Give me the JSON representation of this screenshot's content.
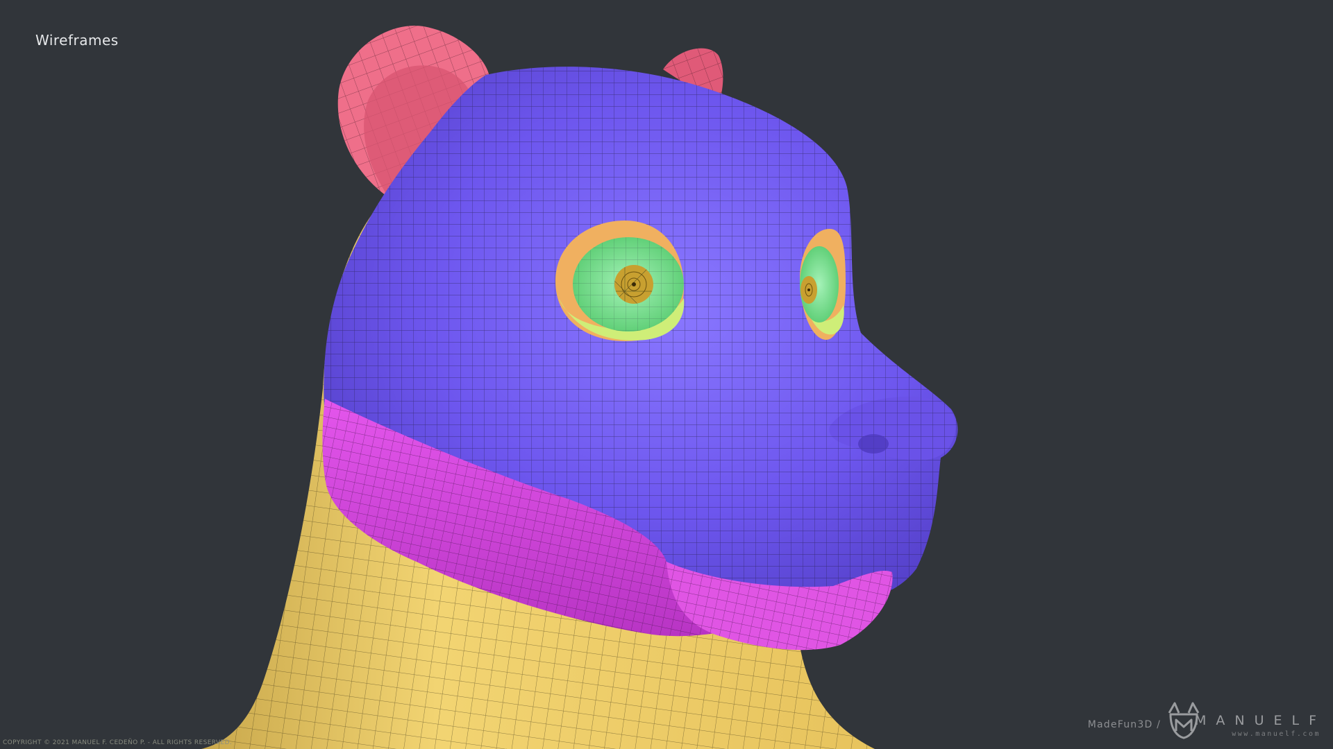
{
  "header": {
    "title": "Wireframes"
  },
  "footer": {
    "copyright": "COPYRIGHT © 2021 MANUEL F. CEDEÑO P. - ALL RIGHTS RESERVED.",
    "studio": "MadeFun3D /",
    "brand_name": "MANUELF",
    "brand_url": "www.manuelf.com"
  },
  "colors": {
    "background": "#31353a",
    "head": "#6b54ec",
    "head_highlight": "#8470ff",
    "muzzle_band": "#d848e0",
    "lip": "#e055e4",
    "neck": "#f2d270",
    "ear": "#ef6f8a",
    "eye_ring_outer": "#f0b060",
    "eye_ring_inner": "#cfee78",
    "iris": "#7ae59a",
    "pupil": "#c8a030",
    "wire": "#1c1830"
  },
  "scene": {
    "subject": "bear-head-3d-model"
  }
}
